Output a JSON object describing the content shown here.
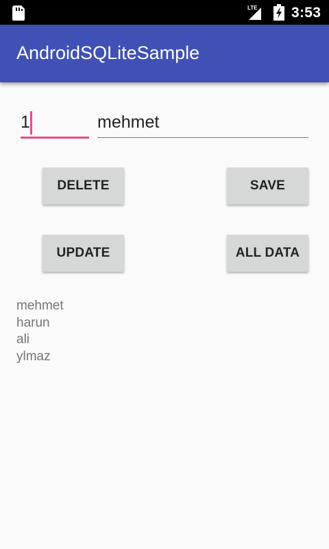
{
  "status_bar": {
    "time": "3:53",
    "network": "LTE"
  },
  "app": {
    "title": "AndroidSQLiteSample",
    "primary_color": "#3f51b5",
    "accent_color": "#e84a8a"
  },
  "form": {
    "id_value": "1",
    "name_value": "mehmet"
  },
  "buttons": {
    "delete": "DELETE",
    "save": "SAVE",
    "update": "UPDATE",
    "all_data": "ALL DATA"
  },
  "results": [
    "mehmet",
    "harun",
    "ali",
    "ylmaz"
  ]
}
